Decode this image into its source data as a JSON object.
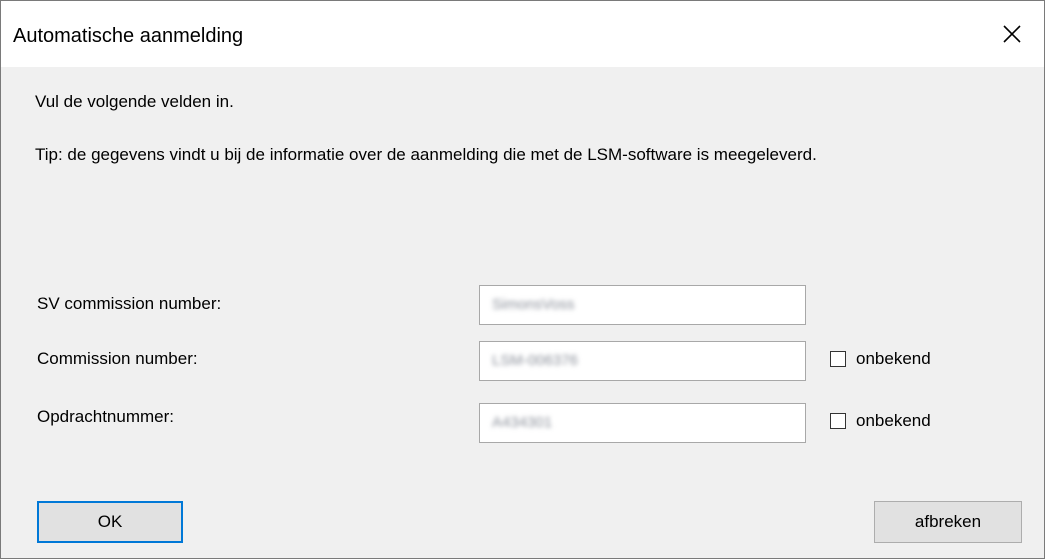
{
  "dialog": {
    "title": "Automatische aanmelding",
    "intro": "Vul de volgende velden in.",
    "tip": "Tip: de gegevens vindt u bij de informatie over de aanmelding die met de LSM-software is meegeleverd."
  },
  "fields": {
    "sv_commission": {
      "label": "SV commission number:",
      "value": "SimonsVoss"
    },
    "commission": {
      "label": "Commission number:",
      "value": "LSM-006376",
      "unknown_label": "onbekend",
      "unknown_checked": false
    },
    "order": {
      "label": "Opdrachtnummer:",
      "value": "A434301",
      "unknown_label": "onbekend",
      "unknown_checked": false
    }
  },
  "buttons": {
    "ok": "OK",
    "cancel": "afbreken"
  },
  "icons": {
    "close": "close-icon"
  },
  "colors": {
    "accent": "#0078d7",
    "titlebar": "#ffffff",
    "background": "#f0f0f0"
  }
}
